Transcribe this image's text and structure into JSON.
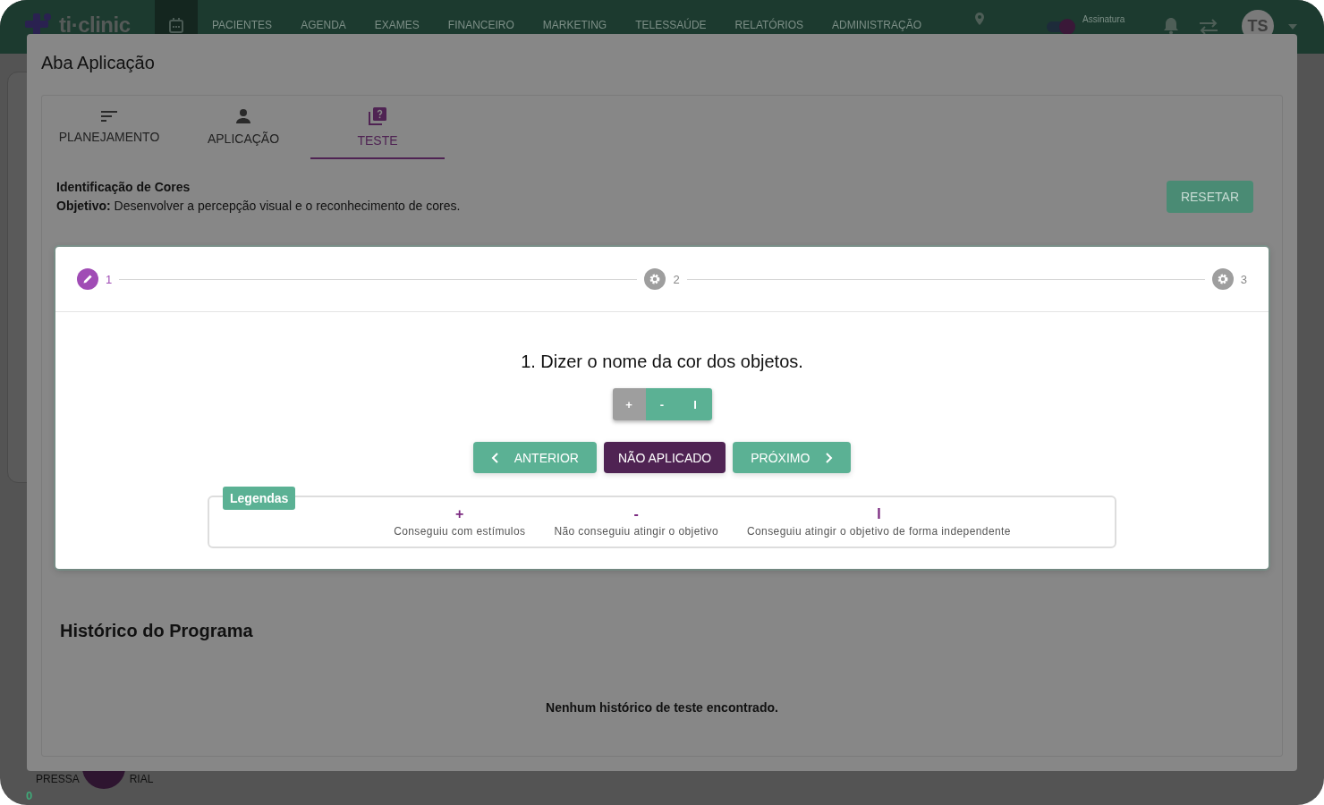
{
  "nav": {
    "logo": "ti·clinic",
    "items": [
      {
        "kind": "icon",
        "selected": true
      },
      {
        "kind": "text",
        "label": "PACIENTES",
        "selected": false
      },
      {
        "kind": "text",
        "label": "AGENDA",
        "selected": false
      },
      {
        "kind": "text",
        "label": "EXAMES",
        "selected": false
      },
      {
        "kind": "text",
        "label": "FINANCEIRO",
        "selected": false
      },
      {
        "kind": "text",
        "label": "MARKETING",
        "selected": false
      },
      {
        "kind": "text",
        "label": "TELESSAÚDE",
        "selected": false
      },
      {
        "kind": "text",
        "label": "RELATÓRIOS",
        "selected": false
      },
      {
        "kind": "text",
        "label": "ADMINISTRAÇÃO",
        "selected": false
      }
    ],
    "signature_on": true,
    "signature": "Assinatura",
    "avatar": "TS"
  },
  "background": {
    "footer_left": "PRESSA",
    "footer_right": "RIAL",
    "footer_count": "0"
  },
  "modal": {
    "title": "Aba Aplicação",
    "tabs": [
      {
        "label": "PLANEJAMENTO",
        "kind": "list",
        "selected": false
      },
      {
        "label": "APLICAÇÃO",
        "kind": "person",
        "selected": false
      },
      {
        "label": "TESTE",
        "kind": "quiz",
        "selected": true
      }
    ],
    "program": {
      "name": "Identificação de Cores",
      "objective": "**Objetivo:** Desenvolver a percepção visual e o reconhecimento de cores."
    },
    "reset_button": "RESETAR",
    "steps": [
      {
        "label": "1",
        "selected": true
      },
      {
        "label": "2",
        "selected": false
      },
      {
        "label": "3",
        "selected": false
      }
    ],
    "question": "1. Dizer o nome da cor dos objetos.",
    "score_options": [
      {
        "label": "+",
        "selected": true
      },
      {
        "label": "-",
        "selected": false
      },
      {
        "label": "I",
        "selected": false
      }
    ],
    "actions": [
      {
        "kind": "prev",
        "label": "ANTERIOR"
      },
      {
        "kind": "skip",
        "label": "NÃO APLICADO"
      },
      {
        "kind": "next",
        "label": "PRÓXIMO"
      }
    ],
    "legend": {
      "title": "Legendas",
      "items": [
        {
          "symbol": "+",
          "text": "Conseguiu com estímulos"
        },
        {
          "symbol": "-",
          "text": "Não conseguiu atingir o objetivo"
        },
        {
          "symbol": "I",
          "text": "Conseguiu atingir o objetivo de forma independente"
        }
      ]
    },
    "history_title": "Histórico do Programa",
    "history_empty": "Nenhum histórico de teste encontrado."
  }
}
